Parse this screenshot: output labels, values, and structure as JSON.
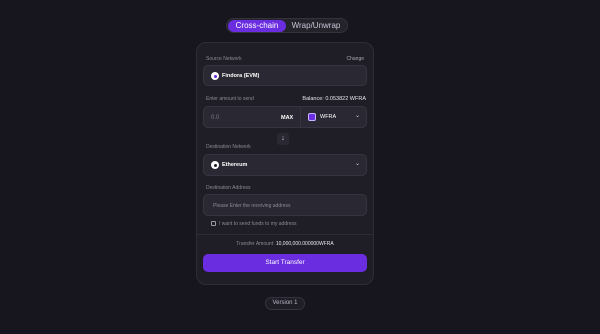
{
  "tabs": [
    {
      "label": "Cross-chain",
      "active": true
    },
    {
      "label": "Wrap/Unwrap",
      "active": false
    }
  ],
  "source": {
    "label": "Source Network",
    "change_label": "Change",
    "network": "Findora (EVM)"
  },
  "amount": {
    "label": "Enter amount to send",
    "balance": "Balance: 0.053822 WFRA",
    "placeholder": "0.0",
    "max_label": "MAX",
    "token": "WFRA"
  },
  "swap_icon": "arrow-down-icon",
  "destination": {
    "label": "Destination Network",
    "network": "Ethereum"
  },
  "address": {
    "label": "Destination Address",
    "placeholder": "Please Enter the receiving address",
    "checkbox_label": "I want to send funds to my address"
  },
  "transfer": {
    "label": "Transfer Amount:",
    "value": "10,000,000.000000WFRA"
  },
  "start_button": "Start Transfer",
  "version": "Version 1",
  "colors": {
    "background": "#17161e",
    "card": "#1f1e27",
    "accent": "#6a2de0"
  }
}
